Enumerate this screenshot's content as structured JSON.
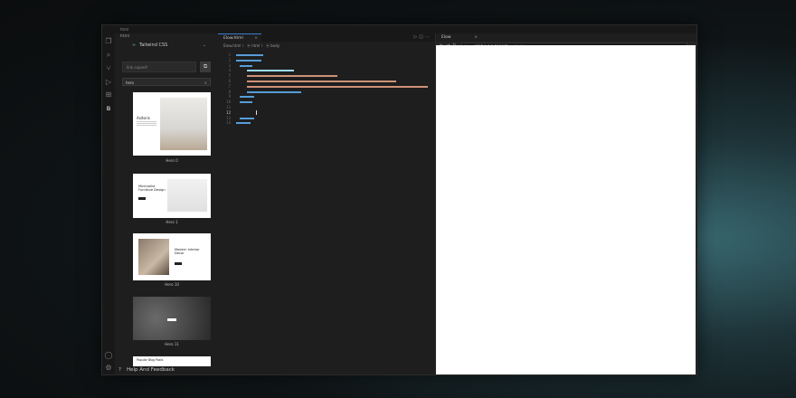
{
  "window": {
    "title": "html"
  },
  "sidebar": {
    "title": "html",
    "framework": "Tailwind CSS",
    "copy_input_placeholder": "link copied!",
    "filter_value": "hero",
    "cards": [
      {
        "label": "Hero 0",
        "heading": "Asitoris",
        "caption": "Asitoris"
      },
      {
        "label": "Hero 1",
        "heading": "Minimalist Furniture Design",
        "caption": "Minimalist Furniture Design"
      },
      {
        "label": "Hero 10",
        "heading": "Modern Interior Decor",
        "caption": "Modern Interior Decor"
      },
      {
        "label": "Hero 11",
        "heading": "",
        "caption": ""
      },
      {
        "label": "",
        "heading": "Popular Blog Posts",
        "caption": "Popular Blog Posts"
      }
    ],
    "footer": "Help And Feedback"
  },
  "editor": {
    "tab_label": "Elow.html",
    "breadcrumb": "Elow.html 〉 ⦿ html 〉 ⦿ body",
    "line_numbers": [
      "1",
      "2",
      "3",
      "4",
      "5",
      "6",
      "7",
      "8",
      "9",
      "10",
      "11",
      "12",
      "13",
      "14"
    ],
    "active_line": "12"
  },
  "preview": {
    "tab_label": "Elow",
    "url": "http://127.0.0.1:3000/Elow.html"
  }
}
